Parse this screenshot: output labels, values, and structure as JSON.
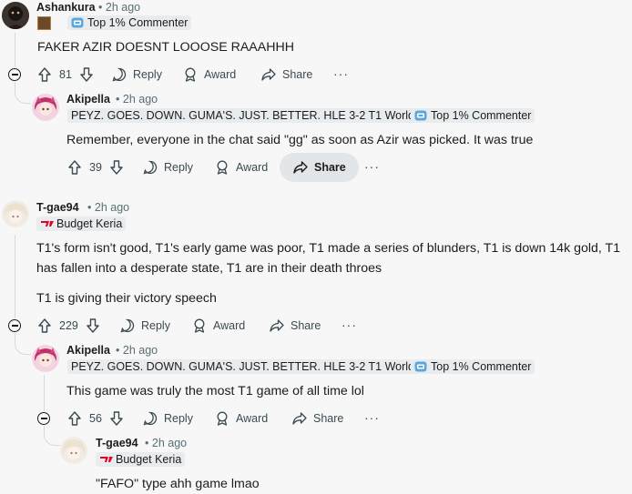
{
  "comments": [
    {
      "author": "Ashankura",
      "time": "2h ago",
      "flair": "Top 1% Commenter",
      "body": "FAKER AZIR DOESNT LOOOSE RAAAHHH",
      "votes": "81",
      "reply": "Reply",
      "award": "Award",
      "share": "Share"
    },
    {
      "author": "Akipella",
      "time": "2h ago",
      "flair_text": "PEYZ. GOES. DOWN. GUMA'S. JUST. BETTER. HLE 3-2 T1 World Finals",
      "flair": "Top 1% Commenter",
      "body": "Remember, everyone in the chat said \"gg\" as soon as Azir was picked. It was true",
      "votes": "39",
      "reply": "Reply",
      "award": "Award",
      "share": "Share"
    },
    {
      "author": "T-gae94",
      "time": "2h ago",
      "flair": "Budget Keria",
      "body1": "T1's form isn't good, T1's early game was poor, T1 made a series of blunders, T1 is down 14k gold, T1 has fallen into a desperate state, T1 are in their death throes",
      "body2": "T1 is giving their victory speech",
      "votes": "229",
      "reply": "Reply",
      "award": "Award",
      "share": "Share"
    },
    {
      "author": "Akipella",
      "time": "2h ago",
      "flair_text": "PEYZ. GOES. DOWN. GUMA'S. JUST. BETTER. HLE 3-2 T1 World Finals",
      "flair": "Top 1% Commenter",
      "body": "This game was truly the most T1 game of all time lol",
      "votes": "56",
      "reply": "Reply",
      "award": "Award",
      "share": "Share"
    },
    {
      "author": "T-gae94",
      "time": "2h ago",
      "flair": "Budget Keria",
      "body": "\"FAFO\" type ahh game lmao"
    }
  ],
  "separator": "•",
  "more": "···",
  "colors": {
    "text": "#1c1c1c",
    "meta": "#576f76",
    "flair_bg": "#e9ecee",
    "share_active_bg": "#e3e6e8"
  }
}
